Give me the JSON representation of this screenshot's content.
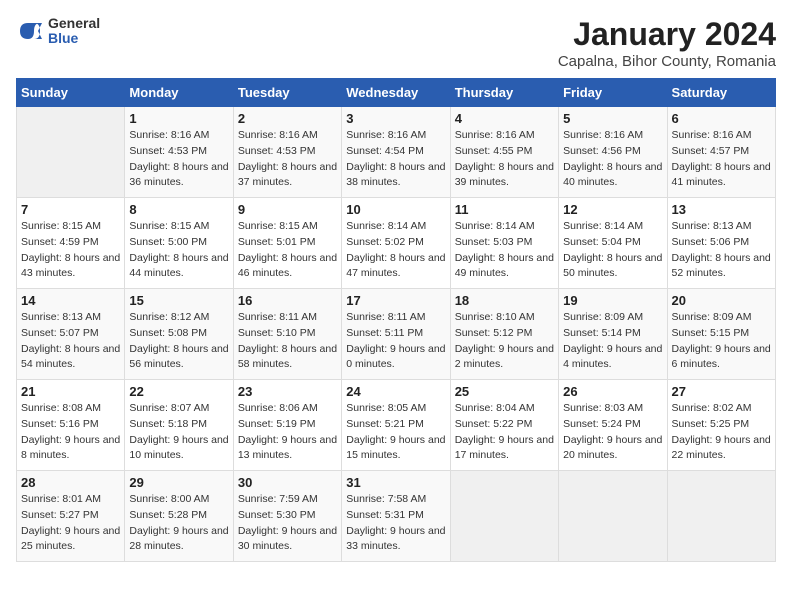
{
  "logo": {
    "general": "General",
    "blue": "Blue"
  },
  "title": "January 2024",
  "subtitle": "Capalna, Bihor County, Romania",
  "days_of_week": [
    "Sunday",
    "Monday",
    "Tuesday",
    "Wednesday",
    "Thursday",
    "Friday",
    "Saturday"
  ],
  "weeks": [
    [
      {
        "day": "",
        "sunrise": "",
        "sunset": "",
        "daylight": ""
      },
      {
        "day": "1",
        "sunrise": "Sunrise: 8:16 AM",
        "sunset": "Sunset: 4:53 PM",
        "daylight": "Daylight: 8 hours and 36 minutes."
      },
      {
        "day": "2",
        "sunrise": "Sunrise: 8:16 AM",
        "sunset": "Sunset: 4:53 PM",
        "daylight": "Daylight: 8 hours and 37 minutes."
      },
      {
        "day": "3",
        "sunrise": "Sunrise: 8:16 AM",
        "sunset": "Sunset: 4:54 PM",
        "daylight": "Daylight: 8 hours and 38 minutes."
      },
      {
        "day": "4",
        "sunrise": "Sunrise: 8:16 AM",
        "sunset": "Sunset: 4:55 PM",
        "daylight": "Daylight: 8 hours and 39 minutes."
      },
      {
        "day": "5",
        "sunrise": "Sunrise: 8:16 AM",
        "sunset": "Sunset: 4:56 PM",
        "daylight": "Daylight: 8 hours and 40 minutes."
      },
      {
        "day": "6",
        "sunrise": "Sunrise: 8:16 AM",
        "sunset": "Sunset: 4:57 PM",
        "daylight": "Daylight: 8 hours and 41 minutes."
      }
    ],
    [
      {
        "day": "7",
        "sunrise": "Sunrise: 8:15 AM",
        "sunset": "Sunset: 4:59 PM",
        "daylight": "Daylight: 8 hours and 43 minutes."
      },
      {
        "day": "8",
        "sunrise": "Sunrise: 8:15 AM",
        "sunset": "Sunset: 5:00 PM",
        "daylight": "Daylight: 8 hours and 44 minutes."
      },
      {
        "day": "9",
        "sunrise": "Sunrise: 8:15 AM",
        "sunset": "Sunset: 5:01 PM",
        "daylight": "Daylight: 8 hours and 46 minutes."
      },
      {
        "day": "10",
        "sunrise": "Sunrise: 8:14 AM",
        "sunset": "Sunset: 5:02 PM",
        "daylight": "Daylight: 8 hours and 47 minutes."
      },
      {
        "day": "11",
        "sunrise": "Sunrise: 8:14 AM",
        "sunset": "Sunset: 5:03 PM",
        "daylight": "Daylight: 8 hours and 49 minutes."
      },
      {
        "day": "12",
        "sunrise": "Sunrise: 8:14 AM",
        "sunset": "Sunset: 5:04 PM",
        "daylight": "Daylight: 8 hours and 50 minutes."
      },
      {
        "day": "13",
        "sunrise": "Sunrise: 8:13 AM",
        "sunset": "Sunset: 5:06 PM",
        "daylight": "Daylight: 8 hours and 52 minutes."
      }
    ],
    [
      {
        "day": "14",
        "sunrise": "Sunrise: 8:13 AM",
        "sunset": "Sunset: 5:07 PM",
        "daylight": "Daylight: 8 hours and 54 minutes."
      },
      {
        "day": "15",
        "sunrise": "Sunrise: 8:12 AM",
        "sunset": "Sunset: 5:08 PM",
        "daylight": "Daylight: 8 hours and 56 minutes."
      },
      {
        "day": "16",
        "sunrise": "Sunrise: 8:11 AM",
        "sunset": "Sunset: 5:10 PM",
        "daylight": "Daylight: 8 hours and 58 minutes."
      },
      {
        "day": "17",
        "sunrise": "Sunrise: 8:11 AM",
        "sunset": "Sunset: 5:11 PM",
        "daylight": "Daylight: 9 hours and 0 minutes."
      },
      {
        "day": "18",
        "sunrise": "Sunrise: 8:10 AM",
        "sunset": "Sunset: 5:12 PM",
        "daylight": "Daylight: 9 hours and 2 minutes."
      },
      {
        "day": "19",
        "sunrise": "Sunrise: 8:09 AM",
        "sunset": "Sunset: 5:14 PM",
        "daylight": "Daylight: 9 hours and 4 minutes."
      },
      {
        "day": "20",
        "sunrise": "Sunrise: 8:09 AM",
        "sunset": "Sunset: 5:15 PM",
        "daylight": "Daylight: 9 hours and 6 minutes."
      }
    ],
    [
      {
        "day": "21",
        "sunrise": "Sunrise: 8:08 AM",
        "sunset": "Sunset: 5:16 PM",
        "daylight": "Daylight: 9 hours and 8 minutes."
      },
      {
        "day": "22",
        "sunrise": "Sunrise: 8:07 AM",
        "sunset": "Sunset: 5:18 PM",
        "daylight": "Daylight: 9 hours and 10 minutes."
      },
      {
        "day": "23",
        "sunrise": "Sunrise: 8:06 AM",
        "sunset": "Sunset: 5:19 PM",
        "daylight": "Daylight: 9 hours and 13 minutes."
      },
      {
        "day": "24",
        "sunrise": "Sunrise: 8:05 AM",
        "sunset": "Sunset: 5:21 PM",
        "daylight": "Daylight: 9 hours and 15 minutes."
      },
      {
        "day": "25",
        "sunrise": "Sunrise: 8:04 AM",
        "sunset": "Sunset: 5:22 PM",
        "daylight": "Daylight: 9 hours and 17 minutes."
      },
      {
        "day": "26",
        "sunrise": "Sunrise: 8:03 AM",
        "sunset": "Sunset: 5:24 PM",
        "daylight": "Daylight: 9 hours and 20 minutes."
      },
      {
        "day": "27",
        "sunrise": "Sunrise: 8:02 AM",
        "sunset": "Sunset: 5:25 PM",
        "daylight": "Daylight: 9 hours and 22 minutes."
      }
    ],
    [
      {
        "day": "28",
        "sunrise": "Sunrise: 8:01 AM",
        "sunset": "Sunset: 5:27 PM",
        "daylight": "Daylight: 9 hours and 25 minutes."
      },
      {
        "day": "29",
        "sunrise": "Sunrise: 8:00 AM",
        "sunset": "Sunset: 5:28 PM",
        "daylight": "Daylight: 9 hours and 28 minutes."
      },
      {
        "day": "30",
        "sunrise": "Sunrise: 7:59 AM",
        "sunset": "Sunset: 5:30 PM",
        "daylight": "Daylight: 9 hours and 30 minutes."
      },
      {
        "day": "31",
        "sunrise": "Sunrise: 7:58 AM",
        "sunset": "Sunset: 5:31 PM",
        "daylight": "Daylight: 9 hours and 33 minutes."
      },
      {
        "day": "",
        "sunrise": "",
        "sunset": "",
        "daylight": ""
      },
      {
        "day": "",
        "sunrise": "",
        "sunset": "",
        "daylight": ""
      },
      {
        "day": "",
        "sunrise": "",
        "sunset": "",
        "daylight": ""
      }
    ]
  ]
}
